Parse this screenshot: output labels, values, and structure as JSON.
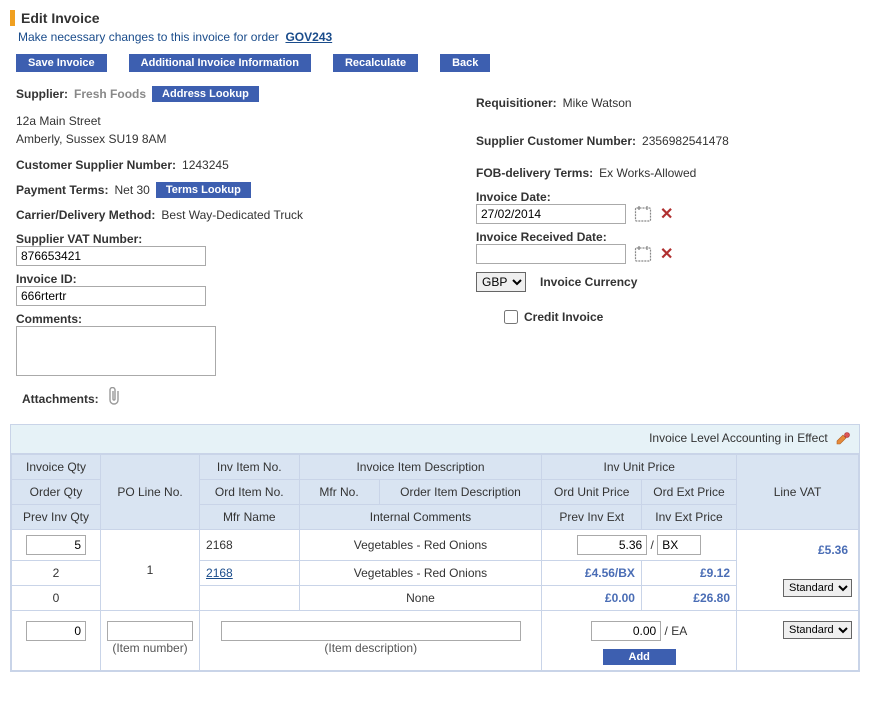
{
  "page": {
    "title": "Edit Invoice",
    "subtitle_prefix": "Make necessary changes to this invoice for order",
    "order_link": "GOV243"
  },
  "buttons": {
    "save": "Save Invoice",
    "additional": "Additional Invoice Information",
    "recalculate": "Recalculate",
    "back": "Back",
    "address_lookup": "Address Lookup",
    "terms_lookup": "Terms Lookup",
    "add": "Add"
  },
  "supplier": {
    "label": "Supplier:",
    "name": "Fresh Foods",
    "addr1": "12a Main Street",
    "addr2": "Amberly, Sussex SU19 8AM"
  },
  "fields": {
    "cust_supp_no_lbl": "Customer Supplier Number:",
    "cust_supp_no": "1243245",
    "payment_terms_lbl": "Payment Terms:",
    "payment_terms": "Net 30",
    "carrier_lbl": "Carrier/Delivery Method:",
    "carrier": "Best Way-Dedicated Truck",
    "supp_vat_lbl": "Supplier VAT Number:",
    "supp_vat": "876653421",
    "invoice_id_lbl": "Invoice ID:",
    "invoice_id": "666rtertr",
    "comments_lbl": "Comments:",
    "comments": "",
    "attachments_lbl": "Attachments:",
    "req_lbl": "Requisitioner:",
    "req_name": "Mike Watson",
    "supp_cust_no_lbl": "Supplier Customer Number:",
    "supp_cust_no": "2356982541478",
    "fob_lbl": "FOB-delivery Terms:",
    "fob": "Ex Works-Allowed",
    "inv_date_lbl": "Invoice Date:",
    "inv_date": "27/02/2014",
    "inv_recv_lbl": "Invoice Received Date:",
    "inv_recv": "",
    "currency_lbl": "Invoice Currency",
    "currency": "GBP",
    "credit_lbl": "Credit Invoice"
  },
  "grid": {
    "level_text": "Invoice Level Accounting in Effect",
    "headers": {
      "inv_qty": "Invoice Qty",
      "order_qty": "Order Qty",
      "prev_inv_qty": "Prev Inv Qty",
      "po_line": "PO Line No.",
      "inv_item_no": "Inv Item No.",
      "ord_item_no": "Ord Item No.",
      "mfr_name": "Mfr Name",
      "mfr_no": "Mfr No.",
      "inv_desc": "Invoice Item Description",
      "ord_desc": "Order Item Description",
      "int_comments": "Internal Comments",
      "inv_unit_price": "Inv Unit Price",
      "ord_unit_price": "Ord Unit Price",
      "ord_ext_price": "Ord Ext Price",
      "prev_inv_ext": "Prev Inv Ext",
      "inv_ext_price": "Inv Ext Price",
      "line_vat": "Line VAT"
    },
    "row1": {
      "inv_qty": "5",
      "order_qty": "2",
      "prev_inv_qty": "0",
      "po_line": "1",
      "inv_item_no": "2168",
      "ord_item_no": "2168",
      "inv_desc": "Vegetables - Red Onions",
      "ord_desc": "Vegetables - Red Onions",
      "int_comments": "None",
      "inv_unit_price": "5.36",
      "inv_uom": "BX",
      "ord_unit_price": "£4.56/BX",
      "ord_ext_price": "£9.12",
      "prev_inv_ext": "£0.00",
      "inv_ext_price": "£26.80",
      "line_vat_total": "£5.36",
      "line_vat_sel": "Standard"
    },
    "row2": {
      "inv_qty": "0",
      "item_no_ph": "(Item number)",
      "desc_ph": "(Item description)",
      "price": "0.00",
      "uom": "EA",
      "vat_sel": "Standard"
    }
  }
}
